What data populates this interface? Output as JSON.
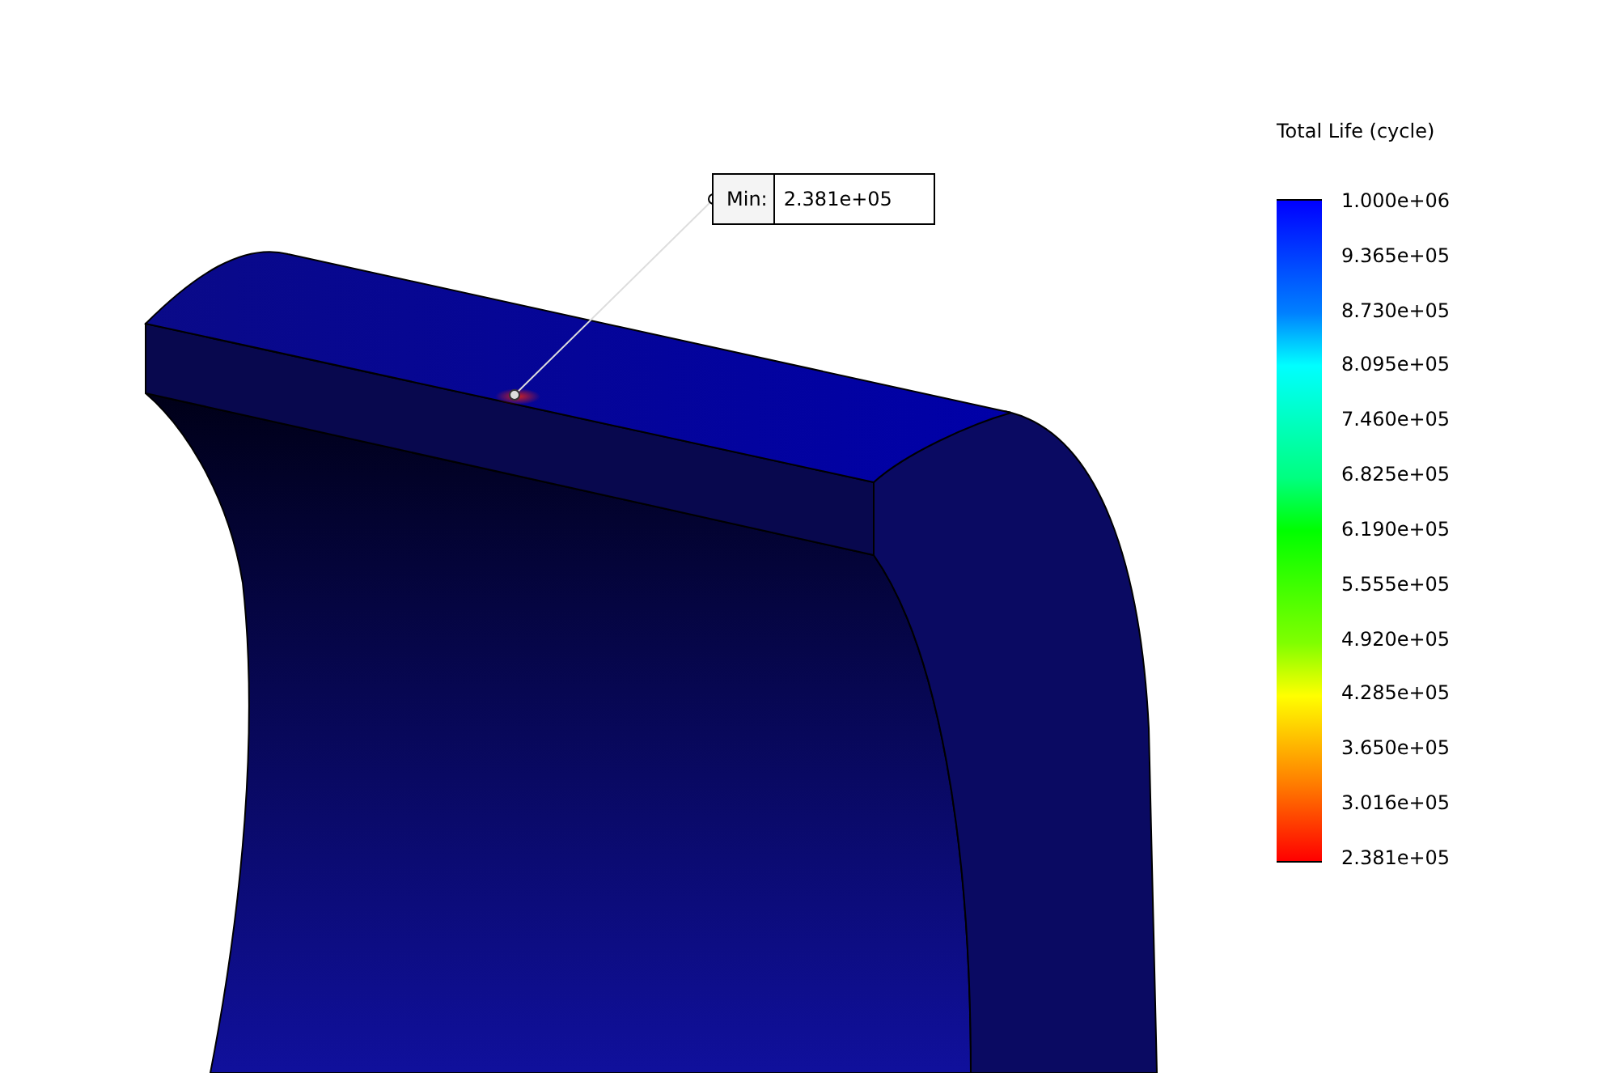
{
  "legend": {
    "title": "Total Life (cycle)",
    "labels": [
      "1.000e+06",
      "9.365e+05",
      "8.730e+05",
      "8.095e+05",
      "7.460e+05",
      "6.825e+05",
      "6.190e+05",
      "5.555e+05",
      "4.920e+05",
      "4.285e+05",
      "3.650e+05",
      "3.016e+05",
      "2.381e+05"
    ]
  },
  "callout": {
    "label": "Min:",
    "value": "2.381e+05"
  }
}
